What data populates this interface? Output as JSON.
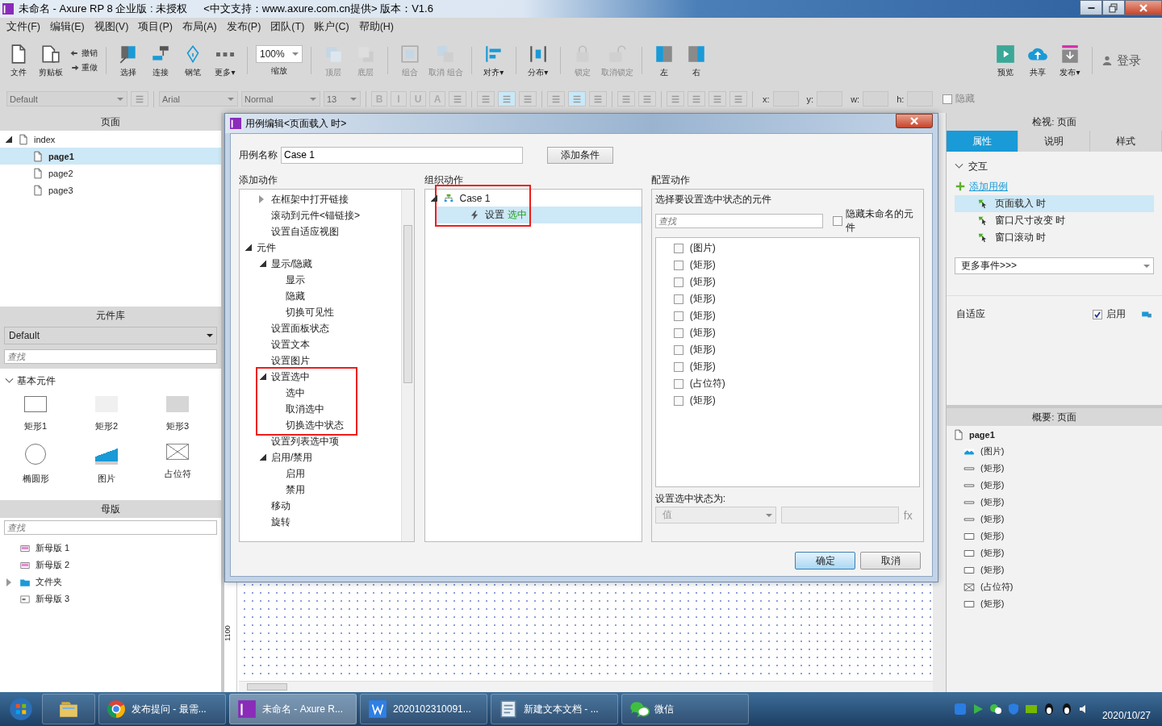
{
  "window": {
    "title": "未命名 - Axure RP 8 企业版 : 未授权",
    "subtitle": "<中文支持：www.axure.com.cn提供> 版本：V1.6"
  },
  "menu": [
    "文件(F)",
    "编辑(E)",
    "视图(V)",
    "项目(P)",
    "布局(A)",
    "发布(P)",
    "团队(T)",
    "账户(C)",
    "帮助(H)"
  ],
  "toolbar": [
    {
      "items": [
        {
          "kind": "file",
          "label": "文件"
        },
        {
          "kind": "clipboard",
          "label": "剪贴板"
        },
        {
          "kind": "stack",
          "items": [
            {
              "label": "撤销"
            },
            {
              "label": "重做"
            }
          ]
        }
      ]
    },
    {
      "items": [
        {
          "kind": "select",
          "label": "选择"
        },
        {
          "kind": "connect",
          "label": "连接"
        },
        {
          "kind": "pen",
          "label": "钢笔"
        },
        {
          "kind": "more",
          "label": "更多▾"
        }
      ]
    },
    {
      "items": [
        {
          "kind": "zoom",
          "value": "100%",
          "label": "缩放"
        }
      ]
    },
    {
      "items": [
        {
          "kind": "top",
          "label": "顶层",
          "disabled": true
        },
        {
          "kind": "bottom",
          "label": "底层",
          "disabled": true
        }
      ]
    },
    {
      "items": [
        {
          "kind": "group",
          "label": "组合",
          "disabled": true
        },
        {
          "kind": "ungroup",
          "label": "取消 组合",
          "disabled": true
        }
      ]
    },
    {
      "items": [
        {
          "kind": "align",
          "label": "对齐▾",
          "disabled": false
        }
      ]
    },
    {
      "items": [
        {
          "kind": "distribute",
          "label": "分布▾",
          "disabled": false
        }
      ]
    },
    {
      "items": [
        {
          "kind": "lock",
          "label": "锁定",
          "disabled": true
        },
        {
          "kind": "unlock",
          "label": "取消锁定",
          "disabled": true
        }
      ]
    },
    {
      "items": [
        {
          "kind": "left",
          "label": "左",
          "disabled": false
        },
        {
          "kind": "right",
          "label": "右",
          "disabled": false
        }
      ]
    }
  ],
  "toolbar_right": [
    {
      "items": [
        {
          "kind": "preview",
          "label": "预览"
        },
        {
          "kind": "share",
          "label": "共享"
        },
        {
          "kind": "publish",
          "label": "发布▾"
        }
      ]
    },
    {
      "items": [
        {
          "kind": "login",
          "label": "登录"
        }
      ]
    }
  ],
  "format_bar": [
    {
      "items": [
        {
          "kind": "select",
          "value": "Default"
        },
        {
          "kind": "tool",
          "selected": false
        }
      ]
    },
    {
      "items": [
        {
          "kind": "select",
          "value": "Arial"
        },
        {
          "kind": "select",
          "value": "Normal"
        },
        {
          "kind": "select",
          "value": "13"
        }
      ]
    },
    {
      "items": [
        {
          "kind": "text",
          "label": "B"
        },
        {
          "kind": "text",
          "label": "I"
        },
        {
          "kind": "text",
          "label": "U"
        },
        {
          "kind": "text",
          "label": "A"
        },
        {
          "kind": "tool",
          "selected": false
        }
      ]
    },
    {
      "items": [
        {
          "kind": "tool",
          "selected": false
        },
        {
          "kind": "tool",
          "selected": true
        },
        {
          "kind": "tool",
          "selected": false
        }
      ]
    },
    {
      "items": [
        {
          "kind": "tool",
          "selected": false
        },
        {
          "kind": "tool",
          "selected": true
        },
        {
          "kind": "tool",
          "selected": false
        }
      ]
    },
    {
      "items": [
        {
          "kind": "tool",
          "selected": false
        },
        {
          "kind": "tool",
          "selected": false
        }
      ]
    },
    {
      "items": [
        {
          "kind": "tool",
          "selected": false
        },
        {
          "kind": "tool",
          "selected": false
        },
        {
          "kind": "tool",
          "selected": false
        },
        {
          "kind": "tool",
          "selected": false
        }
      ]
    },
    {
      "items": [
        {
          "kind": "coord",
          "label": "x:"
        },
        {
          "kind": "coord",
          "label": "y:"
        },
        {
          "kind": "coord",
          "label": "w:"
        },
        {
          "kind": "coord",
          "label": "h:"
        },
        {
          "kind": "check",
          "label": "隐藏",
          "checked": false
        }
      ]
    }
  ],
  "pages": {
    "title": "页面",
    "tree": [
      {
        "label": "index",
        "expanded": true,
        "selected": false,
        "children": [
          {
            "label": "page1",
            "selected": true
          },
          {
            "label": "page2",
            "selected": false
          },
          {
            "label": "page3",
            "selected": false
          }
        ]
      }
    ]
  },
  "library": {
    "title": "元件库",
    "set": "Default",
    "placeholder": "查找",
    "section": "基本元件",
    "expanded": true,
    "widgets": [
      {
        "label": "矩形1",
        "kind": "rect-outline"
      },
      {
        "label": "矩形2",
        "kind": "rect-light"
      },
      {
        "label": "矩形3",
        "kind": "rect-grey"
      },
      {
        "label": "椭圆形",
        "kind": "ellipse"
      },
      {
        "label": "图片",
        "kind": "image"
      },
      {
        "label": "占位符",
        "kind": "placeholder"
      }
    ]
  },
  "masters": {
    "title": "母版",
    "placeholder": "查找",
    "items": [
      {
        "label": "新母版 1",
        "kind": "master"
      },
      {
        "label": "新母版 2",
        "kind": "master"
      },
      {
        "label": "文件夹",
        "kind": "folder",
        "expanded": false
      },
      {
        "label": "新母版 3",
        "kind": "masteralt"
      }
    ]
  },
  "canvas": {
    "ruler_mark": "1100"
  },
  "dialog": {
    "title": "用例编辑<页面载入 时>",
    "case_label": "用例名称",
    "case_name": "Case 1",
    "add_condition": "添加条件",
    "add_header": "添加动作",
    "organize_header": "组织动作",
    "config_header": "配置动作",
    "actions_continued": [
      {
        "label": "在框架中打开链接",
        "expanded": false
      },
      {
        "label": "滚动到元件<锚链接>"
      },
      {
        "label": "设置自适应视图"
      }
    ],
    "actions": [
      {
        "label": "元件",
        "expanded": true,
        "children": [
          {
            "label": "显示/隐藏",
            "expanded": true,
            "children": [
              {
                "label": "显示"
              },
              {
                "label": "隐藏"
              },
              {
                "label": "切换可见性"
              }
            ]
          },
          {
            "label": "设置面板状态"
          },
          {
            "label": "设置文本"
          },
          {
            "label": "设置图片"
          },
          {
            "label": "设置选中",
            "expanded": true,
            "highlight": true,
            "children": [
              {
                "label": "选中"
              },
              {
                "label": "取消选中"
              },
              {
                "label": "切换选中状态"
              }
            ]
          },
          {
            "label": "设置列表选中项"
          },
          {
            "label": "启用/禁用",
            "expanded": true,
            "children": [
              {
                "label": "启用"
              },
              {
                "label": "禁用"
              }
            ]
          },
          {
            "label": "移动"
          },
          {
            "label": "旋转"
          }
        ]
      }
    ],
    "cases": [
      {
        "label": "Case 1",
        "expanded": true,
        "highlight": true,
        "children": [
          {
            "verb": "设置",
            "target": "选中",
            "selected": true
          }
        ]
      }
    ],
    "config": {
      "title": "选择要设置选中状态的元件",
      "placeholder": "查找",
      "hide_unnamed": {
        "label": "隐藏未命名的元件",
        "checked": false
      },
      "widgets": [
        {
          "label": "(图片)",
          "checked": false
        },
        {
          "label": "(矩形)",
          "checked": false
        },
        {
          "label": "(矩形)",
          "checked": false
        },
        {
          "label": "(矩形)",
          "checked": false
        },
        {
          "label": "(矩形)",
          "checked": false
        },
        {
          "label": "(矩形)",
          "checked": false
        },
        {
          "label": "(矩形)",
          "checked": false
        },
        {
          "label": "(矩形)",
          "checked": false
        },
        {
          "label": "(占位符)",
          "checked": false
        },
        {
          "label": "(矩形)",
          "checked": false
        }
      ],
      "state_label": "设置选中状态为:",
      "value_select": "值",
      "fx": "fx"
    },
    "buttons": [
      {
        "label": "确定",
        "primary": true
      },
      {
        "label": "取消",
        "primary": false
      }
    ]
  },
  "inspector": {
    "title": "检视: 页面",
    "tabs": [
      {
        "label": "属性",
        "selected": true
      },
      {
        "label": "说明",
        "selected": false
      },
      {
        "label": "样式",
        "selected": false
      }
    ],
    "section": "交互",
    "expanded": true,
    "add_case": "添加用例",
    "events": [
      {
        "label": "页面载入 时",
        "selected": true
      },
      {
        "label": "窗口尺寸改变 时",
        "selected": false
      },
      {
        "label": "窗口滚动 时",
        "selected": false
      }
    ],
    "more_events": "更多事件>>>",
    "adaptive_label": "自适应",
    "adaptive_enable": {
      "label": "启用",
      "checked": true
    }
  },
  "outline": {
    "title": "概要: 页面",
    "root": "page1",
    "items": [
      {
        "label": "(图片)",
        "kind": "image"
      },
      {
        "label": "(矩形)",
        "kind": "rectline"
      },
      {
        "label": "(矩形)",
        "kind": "rectline"
      },
      {
        "label": "(矩形)",
        "kind": "rectline"
      },
      {
        "label": "(矩形)",
        "kind": "rectline"
      },
      {
        "label": "(矩形)",
        "kind": "rect"
      },
      {
        "label": "(矩形)",
        "kind": "rect"
      },
      {
        "label": "(矩形)",
        "kind": "rect"
      },
      {
        "label": "(占位符)",
        "kind": "placeholder"
      },
      {
        "label": "(矩形)",
        "kind": "rect"
      }
    ]
  },
  "taskbar": {
    "apps": [
      {
        "kind": "explorer",
        "selected": false
      },
      {
        "kind": "chrome",
        "label": "发布提问 - 最需...",
        "selected": false
      },
      {
        "kind": "axure",
        "label": "未命名 - Axure R...",
        "selected": true
      },
      {
        "kind": "doc",
        "label": "2020102310091...",
        "selected": false
      },
      {
        "kind": "notepad",
        "label": "新建文本文档 - ...",
        "selected": false
      },
      {
        "kind": "wechat",
        "label": "微信",
        "selected": false
      }
    ],
    "date": "2020/10/27"
  }
}
